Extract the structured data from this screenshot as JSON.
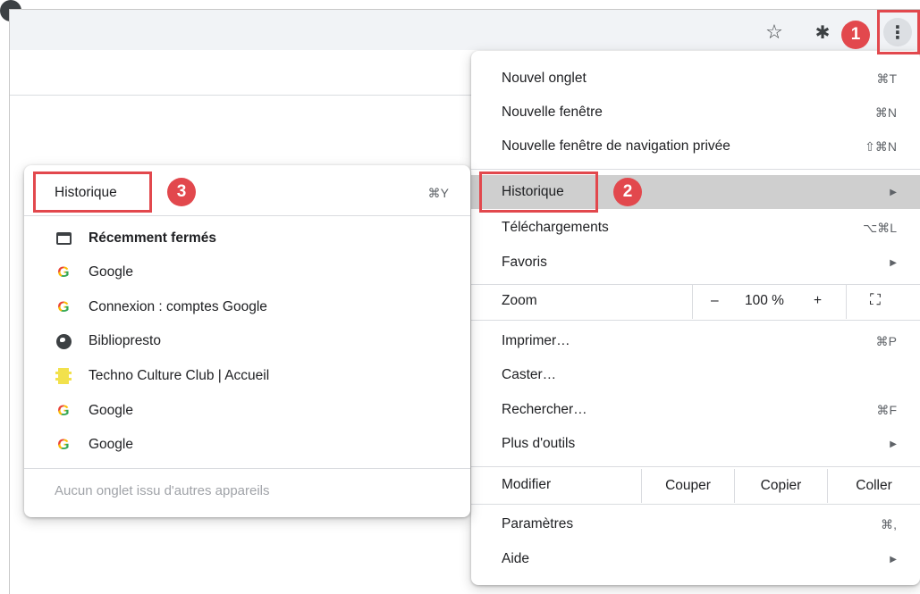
{
  "toolbar": {
    "star_icon": "☆",
    "extensions_icon": "✱",
    "menu_icon": "⋮"
  },
  "badges": [
    "1",
    "2",
    "3"
  ],
  "main_menu": {
    "new_tab": {
      "label": "Nouvel onglet",
      "shortcut": "⌘T"
    },
    "new_window": {
      "label": "Nouvelle fenêtre",
      "shortcut": "⌘N"
    },
    "incognito": {
      "label": "Nouvelle fenêtre de navigation privée",
      "shortcut": "⇧⌘N"
    },
    "history": {
      "label": "Historique",
      "arrow": "▶"
    },
    "downloads": {
      "label": "Téléchargements",
      "shortcut": "⌥⌘L"
    },
    "bookmarks": {
      "label": "Favoris",
      "arrow": "▶"
    },
    "zoom": {
      "label": "Zoom",
      "minus": "–",
      "value": "100 %",
      "plus": "+",
      "fullscreen_icon": "⛶"
    },
    "print": {
      "label": "Imprimer…",
      "shortcut": "⌘P"
    },
    "cast": {
      "label": "Caster…"
    },
    "find": {
      "label": "Rechercher…",
      "shortcut": "⌘F"
    },
    "more_tools": {
      "label": "Plus d'outils",
      "arrow": "▶"
    },
    "edit": {
      "label": "Modifier",
      "cut": "Couper",
      "copy": "Copier",
      "paste": "Coller"
    },
    "settings": {
      "label": "Paramètres",
      "shortcut": "⌘,"
    },
    "help": {
      "label": "Aide",
      "arrow": "▶"
    }
  },
  "history_menu": {
    "header": {
      "label": "Historique",
      "shortcut": "⌘Y"
    },
    "items": [
      {
        "label": "Récemment fermés",
        "icon": "tab-icon"
      },
      {
        "label": "Google",
        "icon": "google-icon"
      },
      {
        "label": "Connexion : comptes Google",
        "icon": "google-icon"
      },
      {
        "label": "Bibliopresto",
        "icon": "globe-icon"
      },
      {
        "label": "Techno Culture Club | Accueil",
        "icon": "techno-culture-club-icon"
      },
      {
        "label": "Google",
        "icon": "google-icon"
      },
      {
        "label": "Google",
        "icon": "google-icon"
      }
    ],
    "empty_message": "Aucun onglet issu d'autres appareils"
  }
}
